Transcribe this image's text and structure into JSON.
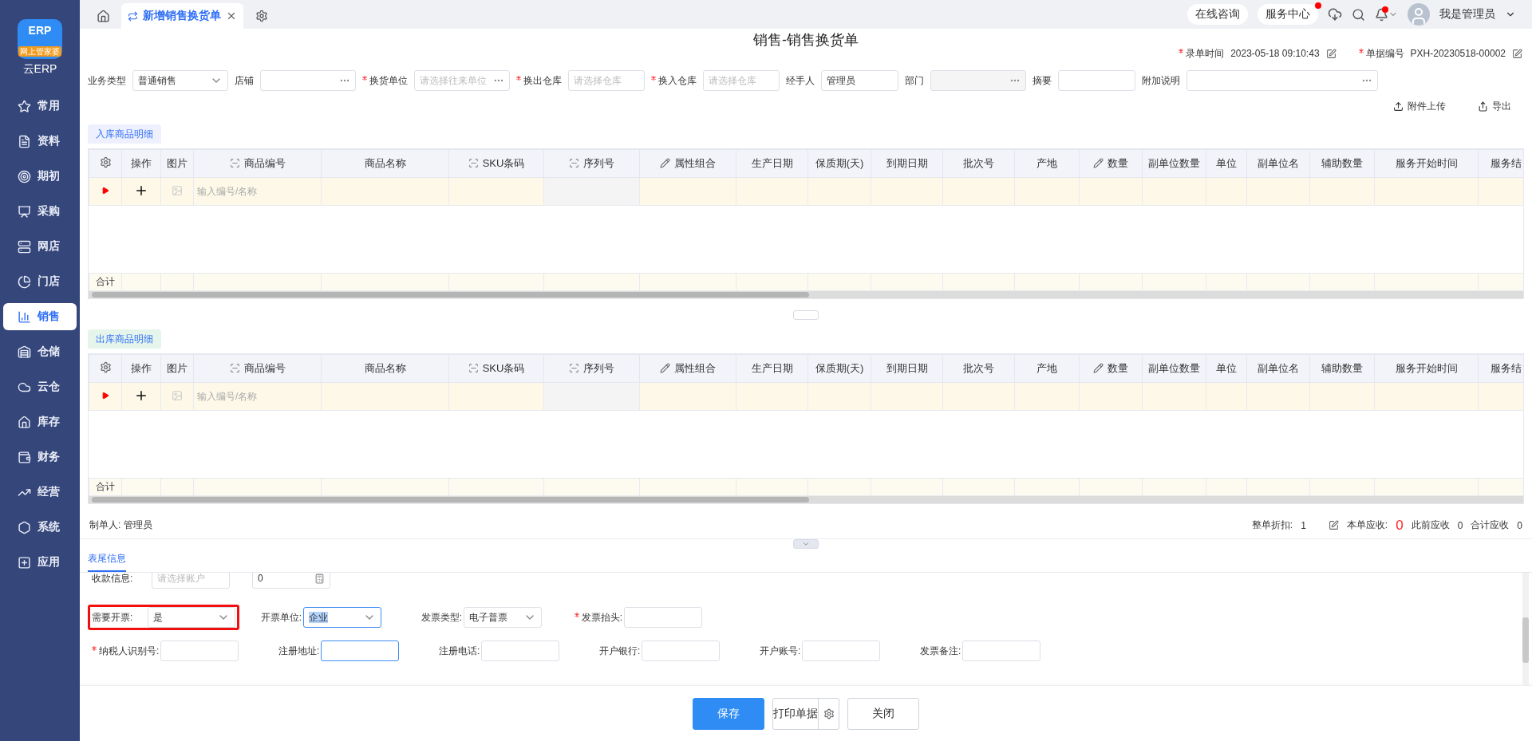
{
  "sidebar": {
    "logo": {
      "mark": "ERP",
      "badge": "网上管家婆",
      "name": "云ERP"
    },
    "items": [
      {
        "label": "常用",
        "selected": false
      },
      {
        "label": "资料",
        "selected": false
      },
      {
        "label": "期初",
        "selected": false
      },
      {
        "label": "采购",
        "selected": false
      },
      {
        "label": "网店",
        "selected": false
      },
      {
        "label": "门店",
        "selected": false
      },
      {
        "label": "销售",
        "selected": true
      },
      {
        "label": "仓储",
        "selected": false
      },
      {
        "label": "云仓",
        "selected": false
      },
      {
        "label": "库存",
        "selected": false
      },
      {
        "label": "财务",
        "selected": false
      },
      {
        "label": "经营",
        "selected": false
      },
      {
        "label": "系统",
        "selected": false
      },
      {
        "label": "应用",
        "selected": false
      }
    ]
  },
  "topbar": {
    "tabs": [
      {
        "label": "新增销售换货单",
        "selected": true
      }
    ],
    "links": [
      {
        "label": "在线咨询",
        "badge": false
      },
      {
        "label": "服务中心",
        "badge": true
      }
    ],
    "notification_badge": true,
    "user": "我是管理员"
  },
  "title": "销售-销售换货单",
  "meta": [
    {
      "label": "录单时间",
      "value": "2023-05-18 09:10:43",
      "required": true
    },
    {
      "label": "单据编号",
      "value": "PXH-20230518-00002",
      "required": true
    }
  ],
  "form_fields": [
    {
      "label": "业务类型",
      "kind": "select",
      "required": false,
      "value": "普通销售"
    },
    {
      "label": "店铺",
      "kind": "lookup",
      "required": false
    },
    {
      "label": "换货单位",
      "kind": "lookup",
      "required": true,
      "placeholder": "请选择往来单位"
    },
    {
      "label": "换出仓库",
      "kind": "picker",
      "required": true,
      "placeholder": "请选择仓库"
    },
    {
      "label": "换入仓库",
      "kind": "picker",
      "required": true,
      "placeholder": "请选择仓库"
    },
    {
      "label": "经手人",
      "kind": "text",
      "required": false,
      "value": "管理员"
    },
    {
      "label": "部门",
      "kind": "disabled",
      "required": false
    },
    {
      "label": "摘要",
      "kind": "text",
      "required": false
    },
    {
      "label": "附加说明",
      "kind": "memo",
      "required": false
    }
  ],
  "actions": [
    {
      "label": "附件上传",
      "kind": "upload"
    },
    {
      "label": "导出",
      "kind": "export"
    }
  ],
  "tables": [
    {
      "title": "入库商品明细",
      "color": "#eef0fd",
      "row_placeholder": "输入编号/名称",
      "total": "合计",
      "columns": [
        {
          "label": "操作",
          "kind": "plain",
          "locked": false
        },
        {
          "label": "图片",
          "kind": "plain",
          "locked": false
        },
        {
          "label": "商品编号",
          "kind": "scan",
          "locked": false
        },
        {
          "label": "商品名称",
          "kind": "plain",
          "locked": false
        },
        {
          "label": "SKU条码",
          "kind": "scan",
          "locked": false
        },
        {
          "label": "序列号",
          "kind": "scan",
          "locked": true
        },
        {
          "label": "属性组合",
          "kind": "edit",
          "locked": false
        },
        {
          "label": "生产日期",
          "kind": "plain",
          "locked": false
        },
        {
          "label": "保质期(天)",
          "kind": "plain",
          "locked": false
        },
        {
          "label": "到期日期",
          "kind": "plain",
          "locked": false
        },
        {
          "label": "批次号",
          "kind": "plain",
          "locked": false
        },
        {
          "label": "产地",
          "kind": "plain",
          "locked": false
        },
        {
          "label": "数量",
          "kind": "edit",
          "locked": false
        },
        {
          "label": "副单位数量",
          "kind": "plain",
          "locked": false
        },
        {
          "label": "单位",
          "kind": "plain",
          "locked": false
        },
        {
          "label": "副单位名",
          "kind": "plain",
          "locked": false
        },
        {
          "label": "辅助数量",
          "kind": "plain",
          "locked": false
        },
        {
          "label": "服务开始时间",
          "kind": "plain",
          "locked": false
        },
        {
          "label": "服务结",
          "kind": "plain",
          "locked": false
        }
      ]
    },
    {
      "title": "出库商品明细",
      "color": "#e6f5ec",
      "row_placeholder": "输入编号/名称",
      "total": "合计",
      "columns": [
        {
          "label": "操作",
          "kind": "plain",
          "locked": false
        },
        {
          "label": "图片",
          "kind": "plain",
          "locked": false
        },
        {
          "label": "商品编号",
          "kind": "scan",
          "locked": false
        },
        {
          "label": "商品名称",
          "kind": "plain",
          "locked": false
        },
        {
          "label": "SKU条码",
          "kind": "scan",
          "locked": false
        },
        {
          "label": "序列号",
          "kind": "scan",
          "locked": true
        },
        {
          "label": "属性组合",
          "kind": "edit",
          "locked": false
        },
        {
          "label": "生产日期",
          "kind": "plain",
          "locked": false
        },
        {
          "label": "保质期(天)",
          "kind": "plain",
          "locked": false
        },
        {
          "label": "到期日期",
          "kind": "plain",
          "locked": false
        },
        {
          "label": "批次号",
          "kind": "plain",
          "locked": false
        },
        {
          "label": "产地",
          "kind": "plain",
          "locked": false
        },
        {
          "label": "数量",
          "kind": "edit",
          "locked": false
        },
        {
          "label": "副单位数量",
          "kind": "plain",
          "locked": false
        },
        {
          "label": "单位",
          "kind": "plain",
          "locked": false
        },
        {
          "label": "副单位名",
          "kind": "plain",
          "locked": false
        },
        {
          "label": "辅助数量",
          "kind": "plain",
          "locked": false
        },
        {
          "label": "服务开始时间",
          "kind": "plain",
          "locked": false
        },
        {
          "label": "服务结",
          "kind": "plain",
          "locked": false
        }
      ]
    }
  ],
  "maker": {
    "label": "制单人:",
    "value": "管理员"
  },
  "summary": [
    {
      "label": "整单折扣:",
      "value": "1",
      "kind": "discount"
    },
    {
      "label": "本单应收:",
      "value": "0",
      "kind": "due"
    },
    {
      "label": "此前应收",
      "value": "0",
      "kind": "plain"
    },
    {
      "label": "合计应收",
      "value": "0",
      "kind": "plain"
    }
  ],
  "tail_tab": "表尾信息",
  "tail_rows": [
    [
      {
        "label": "收款信息:",
        "kind": "account",
        "required": false,
        "placeholder": "请选择账户",
        "highlighted": false,
        "focused": false
      },
      {
        "kind": "amount",
        "value": "0",
        "highlighted": false,
        "focused": false
      }
    ],
    [
      {
        "label": "需要开票:",
        "kind": "select",
        "required": false,
        "value": "是",
        "highlighted": true,
        "focused": false
      },
      {
        "label": "开票单位:",
        "kind": "select",
        "required": false,
        "value": "企业",
        "value_selected": true,
        "highlighted": false,
        "focused": true
      },
      {
        "label": "发票类型:",
        "kind": "select",
        "required": false,
        "value": "电子普票",
        "highlighted": false,
        "focused": false
      },
      {
        "label": "发票抬头:",
        "kind": "text",
        "required": true,
        "highlighted": false,
        "focused": false
      }
    ],
    [
      {
        "label": "纳税人识别号:",
        "kind": "text",
        "required": true,
        "highlighted": false,
        "focused": false
      },
      {
        "label": "注册地址:",
        "kind": "text",
        "required": false,
        "highlighted": false,
        "focused": true
      },
      {
        "label": "注册电话:",
        "kind": "text",
        "required": false,
        "highlighted": false,
        "focused": false
      },
      {
        "label": "开户银行:",
        "kind": "text",
        "required": false,
        "highlighted": false,
        "focused": false
      },
      {
        "label": "开户账号:",
        "kind": "text",
        "required": false,
        "highlighted": false,
        "focused": false
      },
      {
        "label": "发票备注:",
        "kind": "text",
        "required": false,
        "highlighted": false,
        "focused": false
      }
    ]
  ],
  "footer_buttons": [
    {
      "label": "保存",
      "kind": "primary"
    },
    {
      "label": "打印单据",
      "kind": "split"
    },
    {
      "label": "关闭",
      "kind": "plain"
    }
  ]
}
